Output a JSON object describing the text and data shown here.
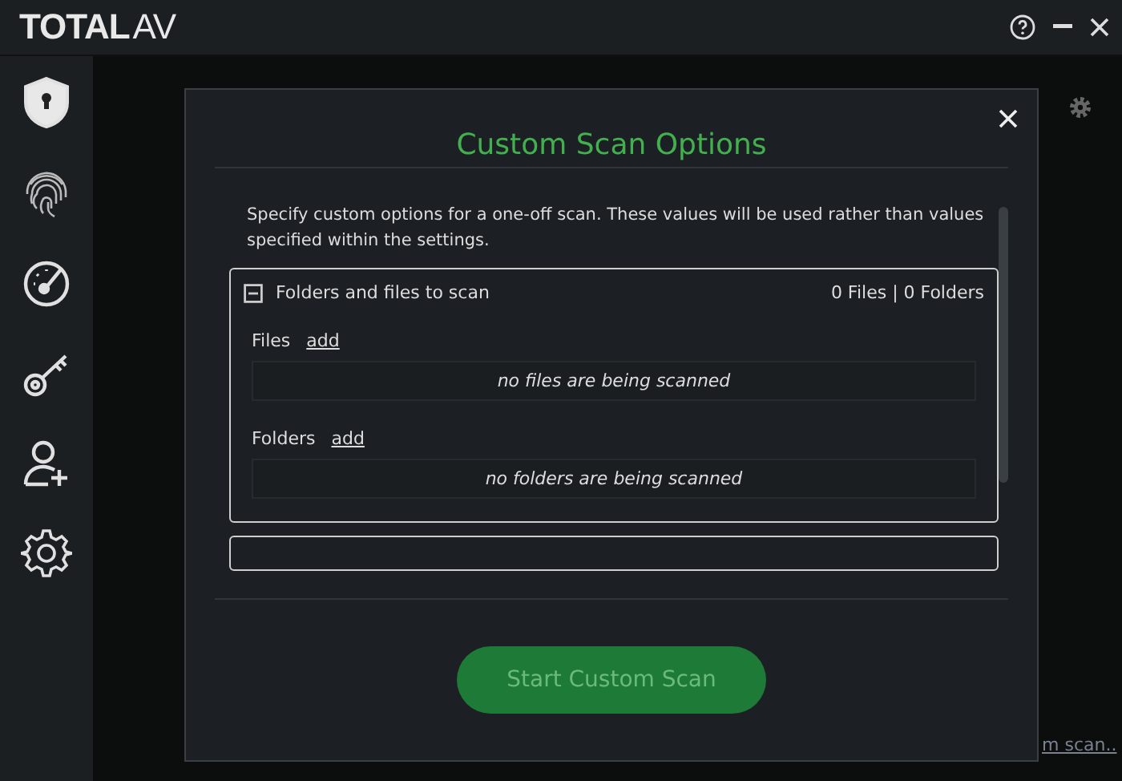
{
  "window": {
    "title_bold": "TOTAL",
    "title_light": "AV"
  },
  "sidebar": {
    "items": [
      {
        "kind": "shield",
        "selected": true
      },
      {
        "kind": "fingerprint",
        "selected": false
      },
      {
        "kind": "speedometer",
        "selected": false
      },
      {
        "kind": "key",
        "selected": false
      },
      {
        "kind": "user-add",
        "selected": false
      },
      {
        "kind": "settings",
        "selected": false
      }
    ]
  },
  "background_link": "m scan..",
  "dialog": {
    "title": "Custom Scan Options",
    "description": "Specify custom options for a one-off scan. These values will be used rather than values specified within the settings.",
    "groups": [
      {
        "title": "Folders and files to scan",
        "expanded": true,
        "summary": "0 Files | 0 Folders",
        "lists": [
          {
            "label": "Files",
            "action": "add",
            "empty_text": "no files are being scanned"
          },
          {
            "label": "Folders",
            "action": "add",
            "empty_text": "no folders are being scanned"
          }
        ]
      },
      {
        "expanded": false
      }
    ],
    "button": "Start Custom Scan"
  }
}
